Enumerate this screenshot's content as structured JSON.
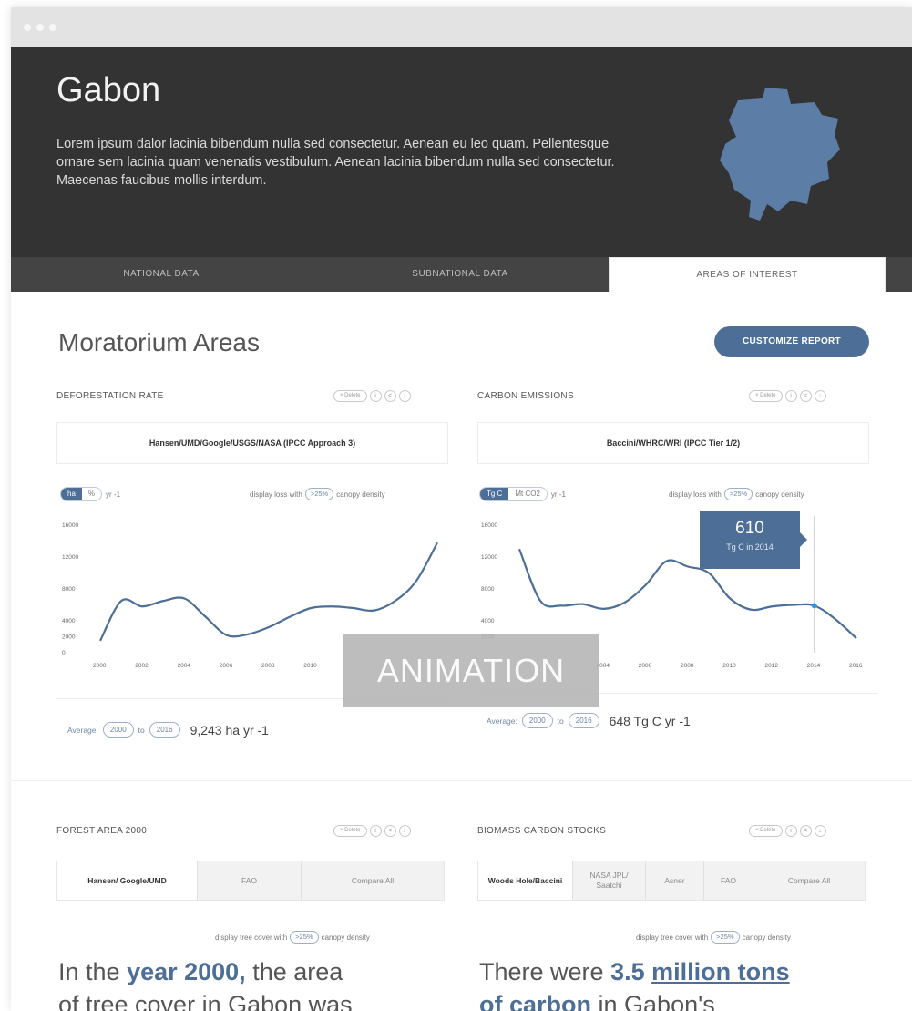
{
  "hero": {
    "title": "Gabon",
    "description": "Lorem ipsum dalor lacinia bibendum nulla sed consectetur. Aenean eu leo quam. Pellentesque ornare sem lacinia quam venenatis vestibulum. Aenean lacinia bibendum nulla sed consectetur. Maecenas faucibus mollis interdum."
  },
  "tabs": [
    {
      "label": "NATIONAL DATA"
    },
    {
      "label": "SUBNATIONAL DATA"
    },
    {
      "label": "AREAS OF INTEREST",
      "active": true
    }
  ],
  "section": {
    "title": "Moratorium Areas",
    "customize_label": "CUSTOMIZE REPORT"
  },
  "widgets": {
    "deforestation": {
      "title": "DEFORESTATION RATE",
      "delete_label": "× Delete",
      "source": "Hansen/UMD/Google/USGS/NASA (IPCC Approach 3)",
      "unit_on": "ha",
      "unit_off": "%",
      "unit_suffix": "yr -1",
      "density_prefix": "display loss with",
      "density_value": ">25%",
      "density_suffix": "canopy density",
      "avg_label": "Average:",
      "avg_from": "2000",
      "avg_to_word": "to",
      "avg_to": "2016",
      "avg_value": "9,243 ha yr -1"
    },
    "carbon": {
      "title": "CARBON EMISSIONS",
      "delete_label": "× Delete",
      "source": "Baccini/WHRC/WRI (IPCC Tier 1/2)",
      "unit_on": "Tg C",
      "unit_off": "Mt CO2",
      "unit_suffix": "yr -1",
      "density_prefix": "display loss with",
      "density_value": ">25%",
      "density_suffix": "canopy density",
      "avg_label": "Average:",
      "avg_from": "2000",
      "avg_to_word": "to",
      "avg_to": "2016",
      "avg_value": "648 Tg C yr -1",
      "tooltip_value": "610",
      "tooltip_label": "Tg C in 2014"
    },
    "forest_area": {
      "title": "FOREST AREA 2000",
      "delete_label": "× Delete",
      "tabs": [
        "Hansen/ Google/UMD",
        "FAO",
        "Compare All"
      ],
      "density_prefix": "display tree cover with",
      "density_value": ">25%",
      "density_suffix": "canopy density",
      "stat_pre": "In the ",
      "stat_hl": "year 2000,",
      "stat_post": " the area",
      "stat_line2": "of tree cover in Gabon was"
    },
    "biomass": {
      "title": "BIOMASS CARBON STOCKS",
      "delete_label": "× Delete",
      "tabs": [
        "Woods Hole/Baccini",
        "NASA JPL/ Saatchi",
        "Asner",
        "FAO",
        "Compare All"
      ],
      "density_prefix": "display tree cover with",
      "density_value": ">25%",
      "density_suffix": "canopy density",
      "stat_pre": "There were ",
      "stat_hl": "3.5",
      "stat_ul": "million tons",
      "stat_line2_hl": "of carbon",
      "stat_line2_rest": " in Gabon's"
    }
  },
  "animation_label": "ANIMATION",
  "colors": {
    "accent": "#4d6f97",
    "hero_bg": "#333333",
    "tabs_bg": "#444444"
  },
  "chart_data": [
    {
      "type": "line",
      "title": "DEFORESTATION RATE",
      "x": [
        2000,
        2001,
        2002,
        2003,
        2004,
        2005,
        2006,
        2007,
        2008,
        2009,
        2010,
        2011,
        2012,
        2013,
        2014,
        2015,
        2016
      ],
      "y": [
        1500,
        6500,
        5800,
        6500,
        6800,
        4500,
        2200,
        2300,
        3200,
        4500,
        5600,
        5800,
        5600,
        5300,
        6500,
        9000,
        13800
      ],
      "yticks": [
        0,
        2000,
        4000,
        8000,
        12000,
        16000
      ],
      "xticks": [
        2000,
        2002,
        2004,
        2006,
        2008,
        2010
      ],
      "ylim": [
        0,
        16000
      ],
      "xlabel": "",
      "ylabel": "",
      "grid": false
    },
    {
      "type": "line",
      "title": "CARBON EMISSIONS",
      "x": [
        2000,
        2001,
        2002,
        2003,
        2004,
        2005,
        2006,
        2007,
        2008,
        2009,
        2010,
        2011,
        2012,
        2013,
        2014,
        2015,
        2016
      ],
      "y": [
        13000,
        6500,
        5900,
        6100,
        5500,
        6300,
        8500,
        11500,
        10800,
        10000,
        6800,
        5400,
        5800,
        6000,
        5900,
        4200,
        1800
      ],
      "yticks": [
        2000,
        4000,
        8000,
        12000,
        16000
      ],
      "xticks": [
        2004,
        2006,
        2008,
        2010,
        2012,
        2014,
        2016
      ],
      "ylim": [
        0,
        16000
      ],
      "highlight": {
        "x": 2014,
        "label": "610",
        "sublabel": "Tg C in 2014"
      },
      "xlabel": "",
      "ylabel": "",
      "grid": false
    }
  ]
}
